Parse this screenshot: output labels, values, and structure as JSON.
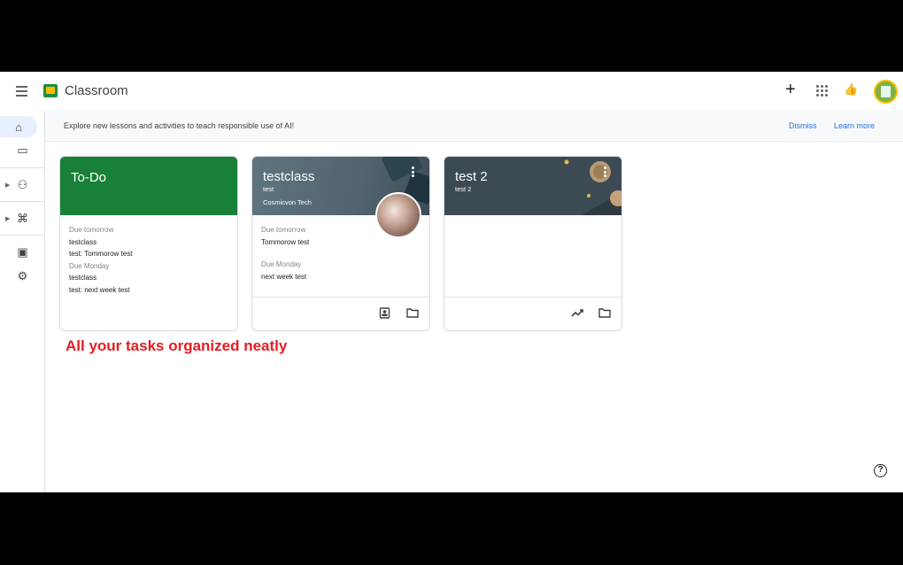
{
  "app": {
    "title": "Classroom"
  },
  "topbar": {
    "create_symbol": "+",
    "thumb_symbol": "👍"
  },
  "sidebar": {
    "items": [
      {
        "icon": "home-icon",
        "glyph": "⌂"
      },
      {
        "icon": "calendar-icon",
        "glyph": "▭"
      },
      {
        "icon": "people-icon",
        "glyph": "⚇"
      },
      {
        "icon": "graduation-cap-icon",
        "glyph": "⌘"
      },
      {
        "icon": "archive-icon",
        "glyph": "▣"
      },
      {
        "icon": "settings-icon",
        "glyph": "⚙"
      }
    ]
  },
  "banner": {
    "text": "Explore new lessons and activities to teach responsible use of AI!",
    "dismiss": "Dismiss",
    "learn_more": "Learn more"
  },
  "cards": {
    "todo": {
      "title": "To-Do",
      "color": "#188038",
      "groups": [
        {
          "due": "Due tomorrow",
          "items": [
            "testclass",
            "test: Tommorow test"
          ]
        },
        {
          "due": "Due Monday",
          "items": [
            "testclass",
            "test: next week test"
          ]
        }
      ]
    },
    "testclass": {
      "title": "testclass",
      "section": "test",
      "owner": "Cosmicvon Tech",
      "color": "#5f7480",
      "groups": [
        {
          "due": "Due tomorrow",
          "items": [
            "Tommorow test"
          ]
        },
        {
          "due": "Due Monday",
          "items": [
            "next week test"
          ]
        }
      ]
    },
    "test2": {
      "title": "test 2",
      "section": "test 2",
      "color": "#3c4a54"
    }
  },
  "caption": "All your tasks organized neatly",
  "help": {
    "glyph": "?"
  }
}
